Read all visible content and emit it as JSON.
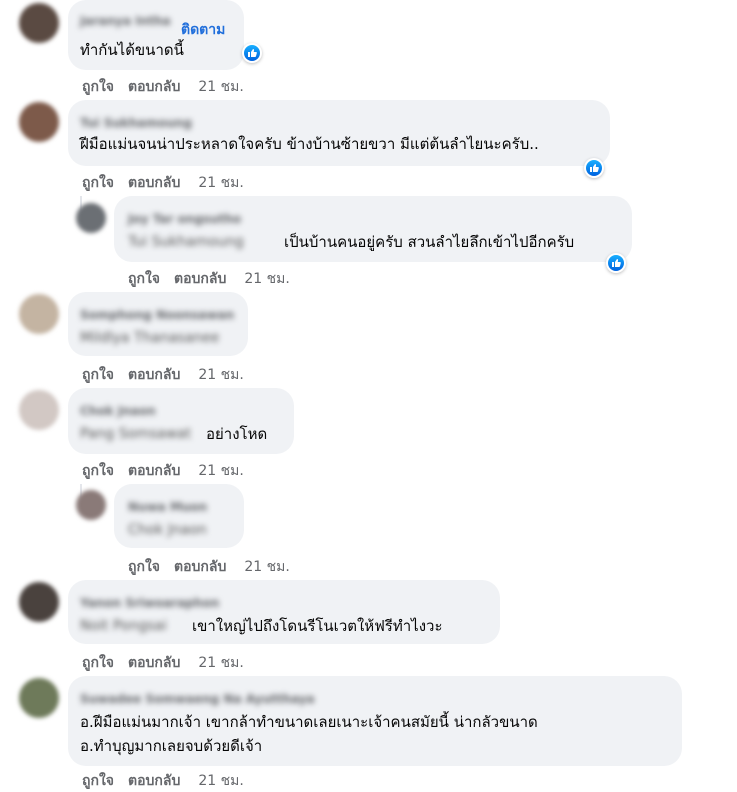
{
  "actions": {
    "like": "ถูกใจ",
    "reply": "ตอบกลับ",
    "time": "21 ชม."
  },
  "c1": {
    "name": "Jaranya Intha",
    "follow": "ติดตาม",
    "text": "ทำกันได้ขนาดนี้"
  },
  "c2": {
    "name": "Tui Sukhamoung",
    "text": "ฝีมือแม่นจนน่าประหลาดใจครับ ข้างบ้านซ้ายขวา มีแต่ต้นลำไยนะครับ.."
  },
  "r1": {
    "name": "Joy Tar ongsutho",
    "tag": "Tui Sukhamoung",
    "text": "เป็นบ้านคนอยู่ครับ สวนลำไยลึกเข้าไปอีกครับ"
  },
  "c3": {
    "name": "Somphong Noonsawan",
    "tag": "Mildlya Thanasanee"
  },
  "c4": {
    "name": "Chok Jnaon",
    "tag": "Pang Somsawat",
    "text": "อย่างโหด"
  },
  "r2": {
    "name": "Nuwa Muon",
    "tag": "Chok Jnaon"
  },
  "c5": {
    "name": "Yanon Sriwoaraphon",
    "tag": "Noit Pongsai",
    "text": "เขาใหญ่ไปถึงโดนรีโนเวตให้ฟรีทำไงวะ"
  },
  "c6": {
    "name": "Suwadee Somwaeng Na Ayutthaya",
    "line1": "อ.ฝีมือแม่นมากเจ้า เขากล้าทำขนาดเลยเนาะเจ้าคนสมัยนี้ น่ากลัวขนาด",
    "line2": "อ.ทำบุญมากเลยจบด้วยดีเจ้า"
  },
  "colors": {
    "bubble": "#f0f2f5",
    "link": "#216fdb",
    "meta": "#65676b",
    "like": "#1877f2"
  }
}
